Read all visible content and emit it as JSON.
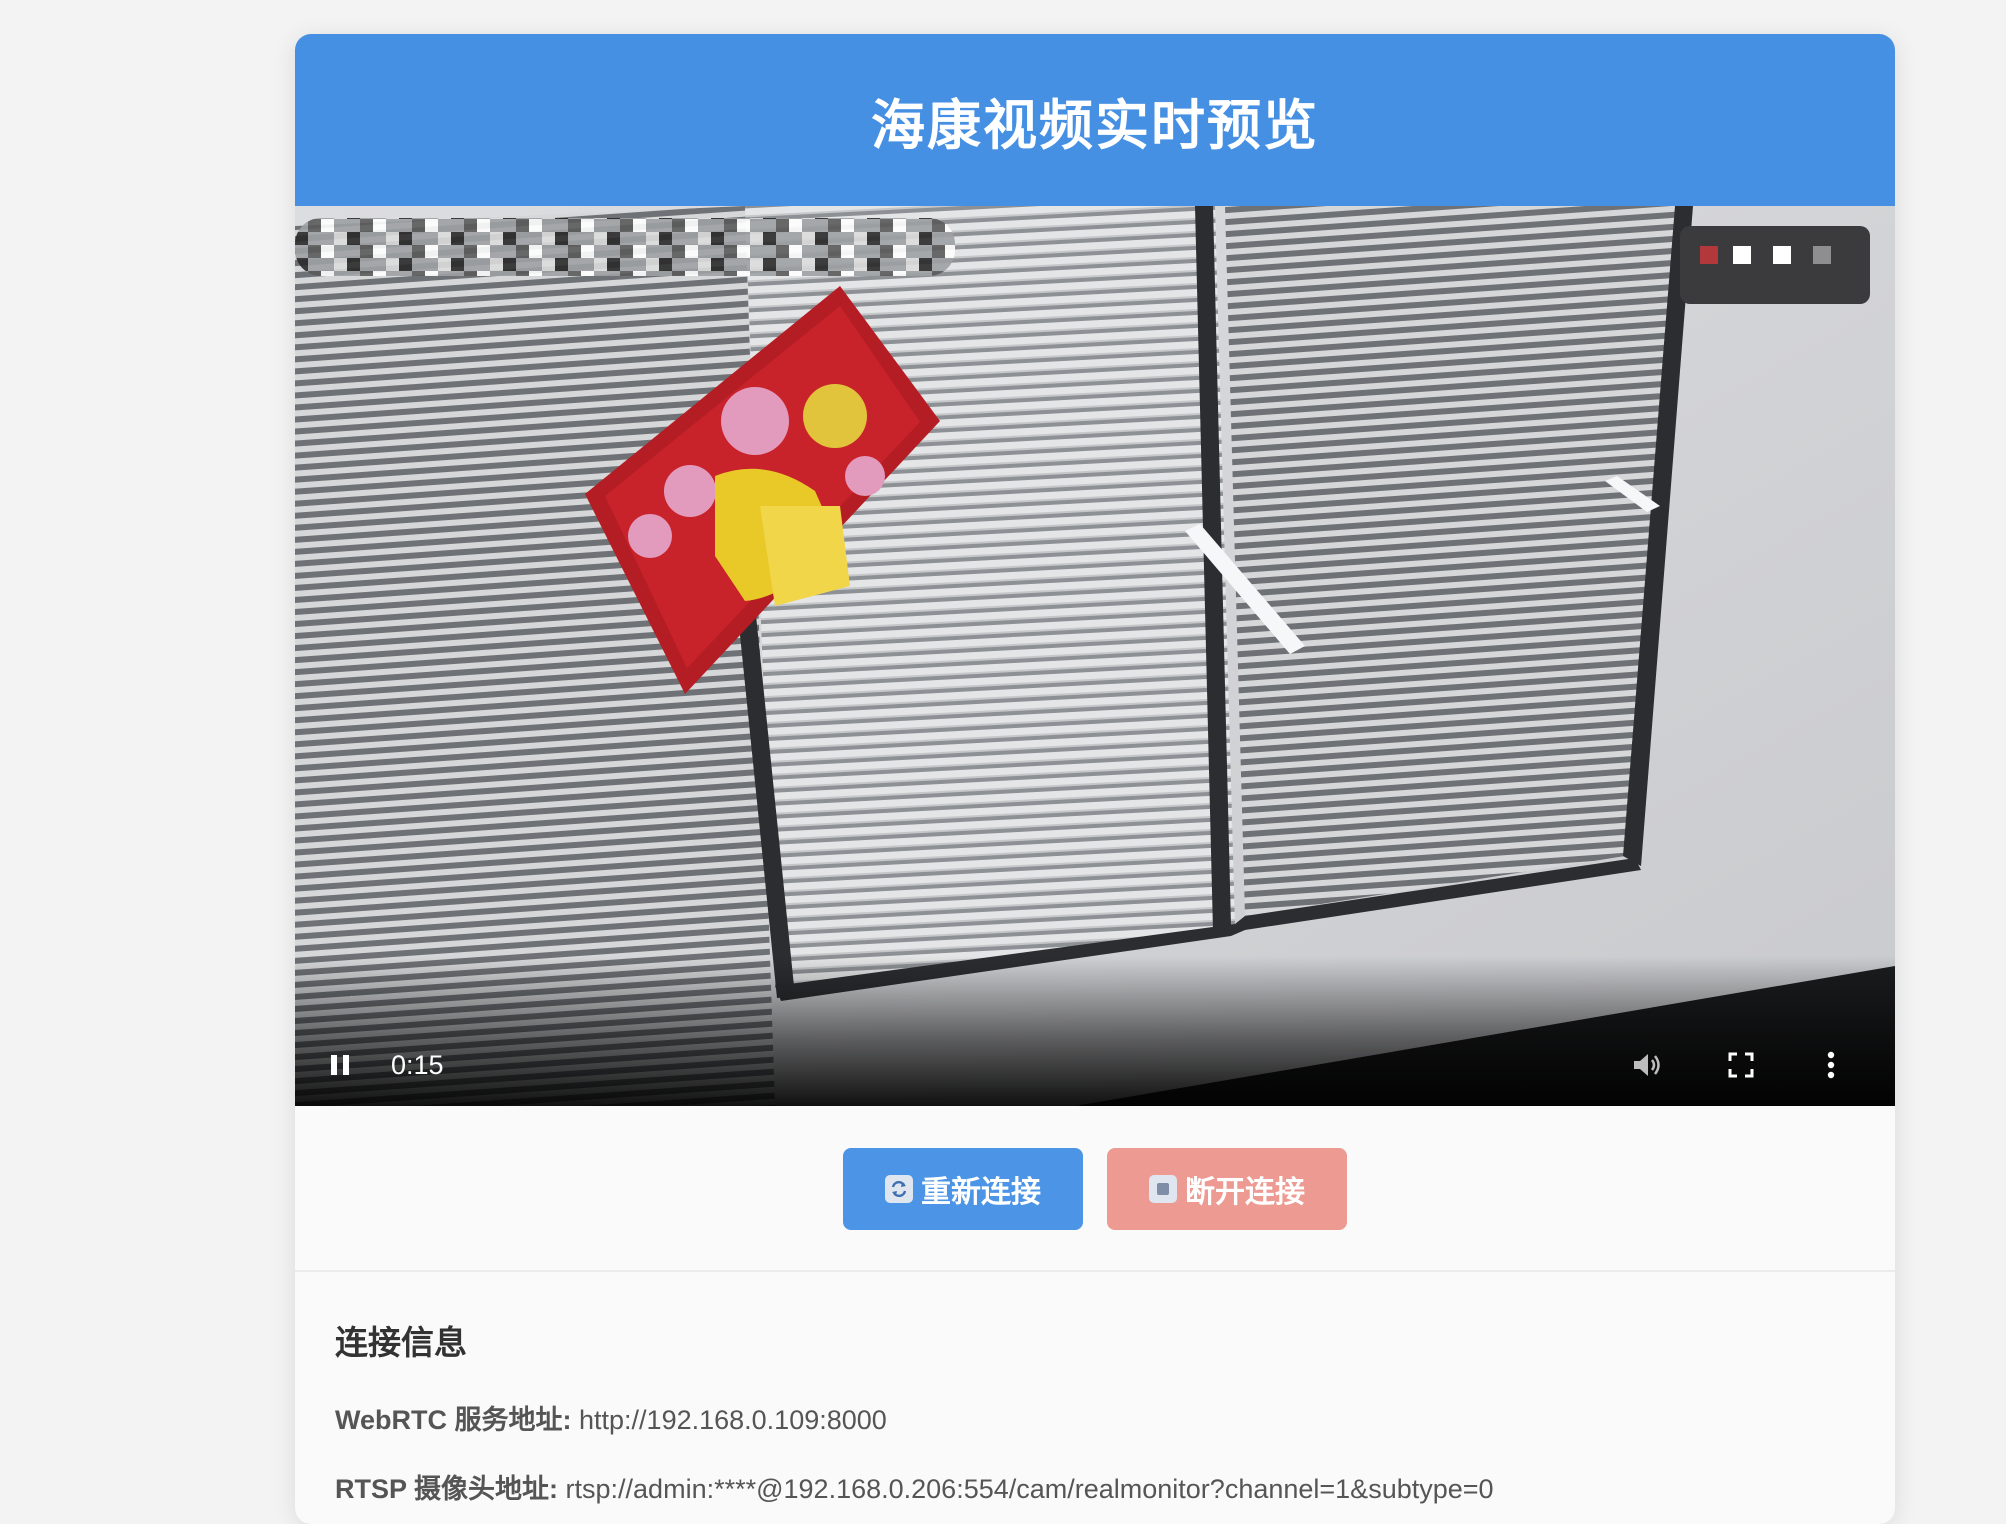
{
  "header": {
    "title": "海康视频实时预览"
  },
  "video": {
    "current_time": "0:15",
    "controls": [
      "play-pause",
      "volume",
      "fullscreen",
      "more-options"
    ]
  },
  "buttons": {
    "reconnect": {
      "icon": "refresh-icon",
      "label": "重新连接"
    },
    "disconnect": {
      "icon": "stop-icon",
      "label": "断开连接"
    }
  },
  "info": {
    "title": "连接信息",
    "rows": [
      {
        "label": "WebRTC 服务地址:",
        "value": "http://192.168.0.109:8000"
      },
      {
        "label": "RTSP 摄像头地址:",
        "value": "rtsp://admin:****@192.168.0.206:554/cam/realmonitor?channel=1&subtype=0"
      }
    ]
  },
  "colors": {
    "header_bg": "#4690e3",
    "reconnect_bg": "#4b94e6",
    "disconnect_bg": "#ec9a92"
  }
}
